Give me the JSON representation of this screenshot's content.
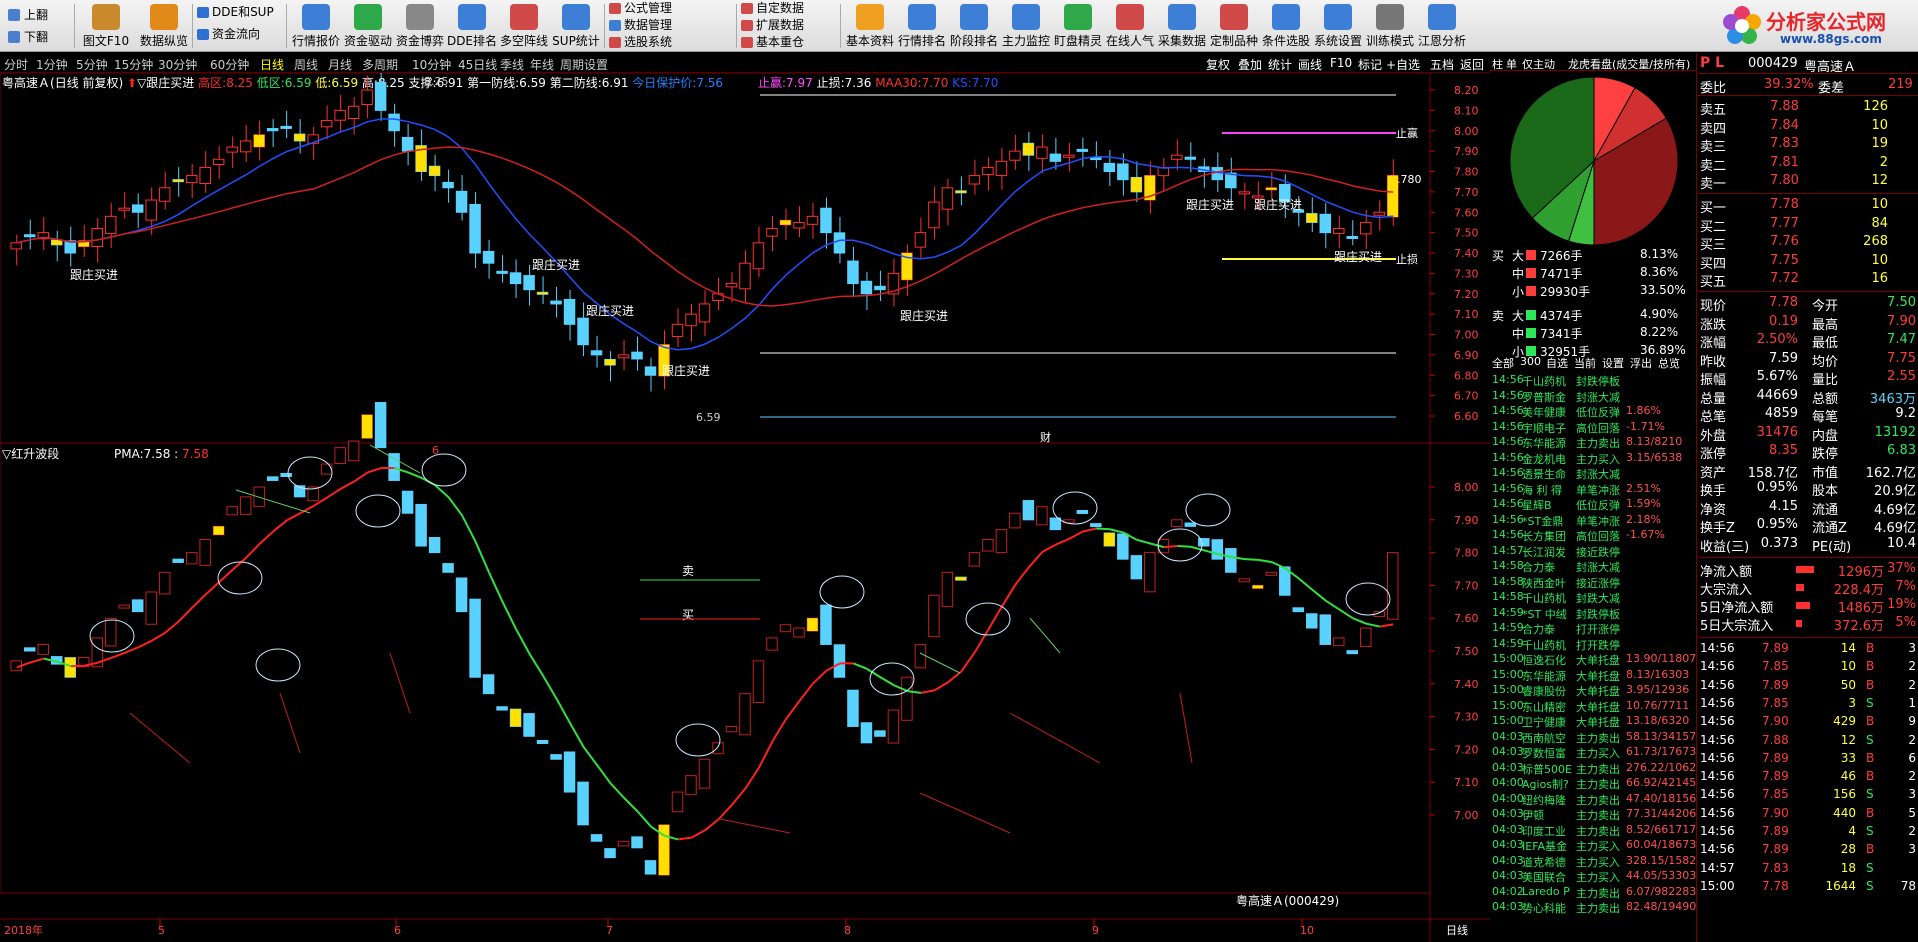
{
  "window": {
    "page_up": "上翻",
    "page_down": "下翻"
  },
  "toolbar": {
    "buttons": [
      {
        "label": "图文F10",
        "icon": "document-icon",
        "color": "#c98a2e"
      },
      {
        "label": "数据纵览",
        "icon": "bar-chart-icon",
        "color": "#e08a1a"
      },
      {
        "label": "行情报价",
        "icon": "quote-icon",
        "color": "#3d7fd6"
      },
      {
        "label": "资金驱动",
        "icon": "arrows-icon",
        "color": "#2fa84a"
      },
      {
        "label": "资金博弈",
        "icon": "coins-icon",
        "color": "#888888"
      },
      {
        "label": "DDE排名",
        "icon": "bar-chart-icon",
        "color": "#3d7fd6"
      },
      {
        "label": "多空阵线",
        "icon": "bar-chart-icon",
        "color": "#d04a4a"
      },
      {
        "label": "SUP统计",
        "icon": "bar-chart-icon",
        "color": "#3d7fd6"
      },
      {
        "label": "基本资料",
        "icon": "f10-icon",
        "color": "#f0a020"
      },
      {
        "label": "行情排名",
        "icon": "monitor-icon",
        "color": "#3d7fd6"
      },
      {
        "label": "阶段排名",
        "icon": "globe-icon",
        "color": "#3d7fd6"
      },
      {
        "label": "主力监控",
        "icon": "shield-icon",
        "color": "#3d7fd6"
      },
      {
        "label": "盯盘精灵",
        "icon": "eye-icon",
        "color": "#2fa84a"
      },
      {
        "label": "在线人气",
        "icon": "people-icon",
        "color": "#d04a4a"
      },
      {
        "label": "采集数据",
        "icon": "tv-icon",
        "color": "#3d7fd6"
      },
      {
        "label": "定制品种",
        "icon": "doc-chart-icon",
        "color": "#d04a4a"
      },
      {
        "label": "条件选股",
        "icon": "speaker-icon",
        "color": "#3d7fd6"
      },
      {
        "label": "系统设置",
        "icon": "gear-icon",
        "color": "#3d7fd6"
      },
      {
        "label": "训练模式",
        "icon": "calculator-icon",
        "color": "#777777"
      },
      {
        "label": "江恩分析",
        "icon": "globe-icon",
        "color": "#3d7fd6"
      }
    ],
    "small": [
      {
        "label": "DDE和SUP",
        "color": "#2f6fd0"
      },
      {
        "label": "资金流向",
        "color": "#2f6fd0"
      },
      {
        "label": "公式管理",
        "color": "#d04a4a"
      },
      {
        "label": "数据管理",
        "color": "#3d7fd6"
      },
      {
        "label": "选股系统",
        "color": "#d04a4a"
      },
      {
        "label": "自定数据",
        "color": "#d04a4a"
      },
      {
        "label": "扩展数据",
        "color": "#d04a4a"
      },
      {
        "label": "基本重仓",
        "color": "#d04a4a"
      }
    ],
    "logo": {
      "text": "分析家公式网",
      "url": "www.88gs.com"
    }
  },
  "timeframe": {
    "items": [
      "分时",
      "1分钟",
      "5分钟",
      "15分钟",
      "30分钟",
      "60分钟",
      "日线",
      "周线",
      "月线",
      "多周期",
      "10分钟",
      "45日线",
      "季线",
      "年线",
      "周期设置"
    ],
    "active": "日线"
  },
  "funcbar": {
    "items": [
      "复权",
      "叠加",
      "统计",
      "画线",
      "F10",
      "标记",
      "+自选",
      "五档",
      "返回"
    ]
  },
  "chart": {
    "title": {
      "stock": "粤高速Ａ",
      "mode": "(日线 前复权)",
      "indicator": "▽跟庄买进",
      "high_label": "高区:",
      "high_val": "8.25",
      "low_label": "低区:",
      "low_val": "6.59",
      "lo_label": "低:",
      "lo_val": "6.59",
      "hi_label": "高:",
      "hi_val": "8.25",
      "sup_label": "支撑:",
      "sup_val": "6.91",
      "l1_label": "第一防线:",
      "l1_val": "6.59",
      "l2_label": "第二防线:",
      "l2_val": "6.91",
      "prot_label": "今日保护价:",
      "prot_val": "7.56"
    },
    "lines_legend": {
      "stop_profit_label": "止赢:",
      "stop_profit": "7.97",
      "stop_loss_label": "止损:",
      "stop_loss": "7.36",
      "ma_label": "MAA30:",
      "ma_val": "7.70",
      "ks_label": "KS:",
      "ks_val": "7.70"
    },
    "price_axis": [
      "8.20",
      "8.10",
      "8.00",
      "7.90",
      "7.80",
      "7.70",
      "7.60",
      "7.50",
      "7.40",
      "7.30",
      "7.20",
      "7.10",
      "7.00",
      "6.90",
      "6.80",
      "6.70",
      "6.60"
    ],
    "lower_axis": [
      "8.00",
      "7.90",
      "7.80",
      "7.70",
      "7.60",
      "7.50",
      "7.40",
      "7.30",
      "7.20",
      "7.10",
      "7.00"
    ],
    "annotations": {
      "max": "8.25",
      "min": "6.59",
      "last": "7.780",
      "stop_profit_tag": "止赢",
      "stop_loss_tag": "止损",
      "buy_tag": "跟庄买进",
      "cai": "财",
      "six": "6"
    },
    "lower": {
      "title": "▽红升波段",
      "pma_label": "PMA:",
      "pma_v1": "7.58",
      "pma_v2": "7.58",
      "sell": "卖",
      "buy": "买",
      "stock_tag": "粤高速Ａ(000429)"
    },
    "date_axis": {
      "year": "2018年",
      "months": [
        "5",
        "6",
        "7",
        "8",
        "9",
        "10"
      ],
      "right": "日线"
    }
  },
  "sidebar": {
    "tabs": [
      "柱",
      "单",
      "仅主动",
      "龙虎看盘(成交量/技所有)"
    ],
    "stock_code": "000429",
    "stock_name": "粤高速Ａ",
    "pl": "P L",
    "flow": [
      {
        "side": "买",
        "size": "大",
        "color": "#ff3c3c",
        "vol": "7266手",
        "pct": "8.13%"
      },
      {
        "side": "",
        "size": "中",
        "color": "#ff3c3c",
        "vol": "7471手",
        "pct": "8.36%"
      },
      {
        "side": "",
        "size": "小",
        "color": "#ff3c3c",
        "vol": "29930手",
        "pct": "33.50%"
      },
      {
        "side": "卖",
        "size": "大",
        "color": "#2ee65a",
        "vol": "4374手",
        "pct": "4.90%"
      },
      {
        "side": "",
        "size": "中",
        "color": "#2ee65a",
        "vol": "7341手",
        "pct": "8.22%"
      },
      {
        "side": "",
        "size": "小",
        "color": "#2ee65a",
        "vol": "32951手",
        "pct": "36.89%"
      }
    ],
    "tape_tabs": [
      "全部",
      "300",
      "自选",
      "当前",
      "设置",
      "浮出",
      "总览"
    ],
    "tape": [
      [
        "14:56",
        "千山药机",
        "封跌停板",
        ""
      ],
      [
        "14:56",
        "罗普斯金",
        "封涨大减",
        ""
      ],
      [
        "14:56",
        "美年健康",
        "低位反弹",
        "1.86%"
      ],
      [
        "14:56",
        "宇顺电子",
        "高位回落",
        "-1.71%"
      ],
      [
        "14:56",
        "东华能源",
        "主力卖出",
        "8.13/8210"
      ],
      [
        "14:56",
        "金龙机电",
        "主力买入",
        "3.15/6538"
      ],
      [
        "14:56",
        "透景生命",
        "封涨大减",
        ""
      ],
      [
        "14:56",
        "海 利 得",
        "单笔冲涨",
        "2.51%"
      ],
      [
        "14:56",
        "星辉B",
        "低位反弹",
        "1.59%"
      ],
      [
        "14:56",
        "*ST金鼎",
        "单笔冲涨",
        "2.18%"
      ],
      [
        "14:56",
        "长方集团",
        "高位回落",
        "-1.67%"
      ],
      [
        "14:57",
        "长江润发",
        "接近跌停",
        ""
      ],
      [
        "14:58",
        "合力泰",
        "封涨大减",
        ""
      ],
      [
        "14:58",
        "陕西金叶",
        "接近涨停",
        ""
      ],
      [
        "14:58",
        "千山药机",
        "封跌大减",
        ""
      ],
      [
        "14:59",
        "*ST 中绒",
        "封跌停板",
        ""
      ],
      [
        "14:59",
        "合力泰",
        "打开涨停",
        ""
      ],
      [
        "14:59",
        "千山药机",
        "打开跌停",
        ""
      ],
      [
        "15:00",
        "恒逸石化",
        "大单托盘",
        "13.90/11807"
      ],
      [
        "15:00",
        "东华能源",
        "大单托盘",
        "8.13/16303"
      ],
      [
        "15:00",
        "睿康股份",
        "大单托盘",
        "3.95/12936"
      ],
      [
        "15:00",
        "东山精密",
        "大单托盘",
        "10.76/7711"
      ],
      [
        "15:00",
        "卫宁健康",
        "大单托盘",
        "13.18/6320"
      ],
      [
        "04:03",
        "西南航空",
        "主力卖出",
        "58.13/34157"
      ],
      [
        "04:03",
        "罗数恒富",
        "主力买入",
        "61.73/17673"
      ],
      [
        "04:03",
        "标普500E",
        "主力卖出",
        "276.22/1062"
      ],
      [
        "04:00",
        "Agios制?",
        "主力卖出",
        "66.92/42145"
      ],
      [
        "04:00",
        "纽约梅隆",
        "主力卖出",
        "47.40/18156"
      ],
      [
        "04:03",
        "伊顿",
        "主力卖出",
        "77.31/44206"
      ],
      [
        "04:03",
        "印度工业",
        "主力卖出",
        "8.52/661717"
      ],
      [
        "04:03",
        "IEFA基金",
        "主力买入",
        "60.04/18673"
      ],
      [
        "04:03",
        "道克希德",
        "主力买入",
        "328.15/1582"
      ],
      [
        "04:03",
        "美国联合",
        "主力买入",
        "44.05/53303"
      ],
      [
        "04:02",
        "Laredo P",
        "主力卖出",
        "6.07/982283"
      ],
      [
        "04:03",
        "势心科能",
        "主力卖出",
        "82.48/19490"
      ]
    ],
    "ratio": {
      "wb_label": "委比",
      "wb": "39.32%",
      "wc_label": "委差",
      "wc": "219"
    },
    "asks": [
      [
        "卖五",
        "7.88",
        "126"
      ],
      [
        "卖四",
        "7.84",
        "10"
      ],
      [
        "卖三",
        "7.83",
        "19"
      ],
      [
        "卖二",
        "7.81",
        "2"
      ],
      [
        "卖一",
        "7.80",
        "12"
      ]
    ],
    "bids": [
      [
        "买一",
        "7.78",
        "10"
      ],
      [
        "买二",
        "7.77",
        "84"
      ],
      [
        "买三",
        "7.76",
        "268"
      ],
      [
        "买四",
        "7.75",
        "10"
      ],
      [
        "买五",
        "7.72",
        "16"
      ]
    ],
    "quote": [
      [
        "现价",
        "7.78",
        "red",
        "今开",
        "7.50",
        "grn"
      ],
      [
        "涨跌",
        "0.19",
        "red",
        "最高",
        "7.90",
        "red"
      ],
      [
        "涨幅",
        "2.50%",
        "red",
        "最低",
        "7.47",
        "grn"
      ],
      [
        "昨收",
        "7.59",
        "wht",
        "均价",
        "7.75",
        "red"
      ],
      [
        "振幅",
        "5.67%",
        "wht",
        "量比",
        "2.55",
        "red"
      ],
      [
        "总量",
        "44669",
        "wht",
        "总额",
        "3463万",
        "cyn"
      ],
      [
        "总笔",
        "4859",
        "wht",
        "每笔",
        "9.2",
        "wht"
      ],
      [
        "外盘",
        "31476",
        "red",
        "内盘",
        "13192",
        "grn"
      ],
      [
        "涨停",
        "8.35",
        "red",
        "跌停",
        "6.83",
        "grn"
      ],
      [
        "资产",
        "158.7亿",
        "wht",
        "市值",
        "162.7亿",
        "wht"
      ],
      [
        "换手",
        "0.95%",
        "wht",
        "股本",
        "20.9亿",
        "wht"
      ],
      [
        "净资",
        "4.15",
        "wht",
        "流通",
        "4.69亿",
        "wht"
      ],
      [
        "换手Z",
        "0.95%",
        "wht",
        "流通Z",
        "4.69亿",
        "wht"
      ],
      [
        "收益(三)",
        "0.373",
        "wht",
        "PE(动)",
        "10.4",
        "wht"
      ]
    ],
    "money": [
      [
        "净流入额",
        "1296万",
        "37%"
      ],
      [
        "大宗流入",
        "228.4万",
        "7%"
      ],
      [
        "5日净流入额",
        "1486万",
        "19%"
      ],
      [
        "5日大宗流入",
        "372.6万",
        "5%"
      ]
    ],
    "ticks": [
      [
        "14:56",
        "7.89",
        "14",
        "B",
        "3"
      ],
      [
        "14:56",
        "7.85",
        "10",
        "B",
        "2"
      ],
      [
        "14:56",
        "7.89",
        "50",
        "B",
        "2"
      ],
      [
        "14:56",
        "7.85",
        "3",
        "S",
        "1"
      ],
      [
        "14:56",
        "7.90",
        "429",
        "B",
        "9"
      ],
      [
        "14:56",
        "7.88",
        "12",
        "S",
        "2"
      ],
      [
        "14:56",
        "7.89",
        "33",
        "B",
        "6"
      ],
      [
        "14:56",
        "7.89",
        "46",
        "B",
        "2"
      ],
      [
        "14:56",
        "7.85",
        "156",
        "S",
        "3"
      ],
      [
        "14:56",
        "7.90",
        "440",
        "B",
        "5"
      ],
      [
        "14:56",
        "7.89",
        "4",
        "S",
        "2"
      ],
      [
        "14:56",
        "7.89",
        "28",
        "B",
        "3"
      ],
      [
        "14:57",
        "7.83",
        "18",
        "S",
        ""
      ],
      [
        "15:00",
        "7.78",
        "1644",
        "S",
        "78"
      ]
    ]
  }
}
